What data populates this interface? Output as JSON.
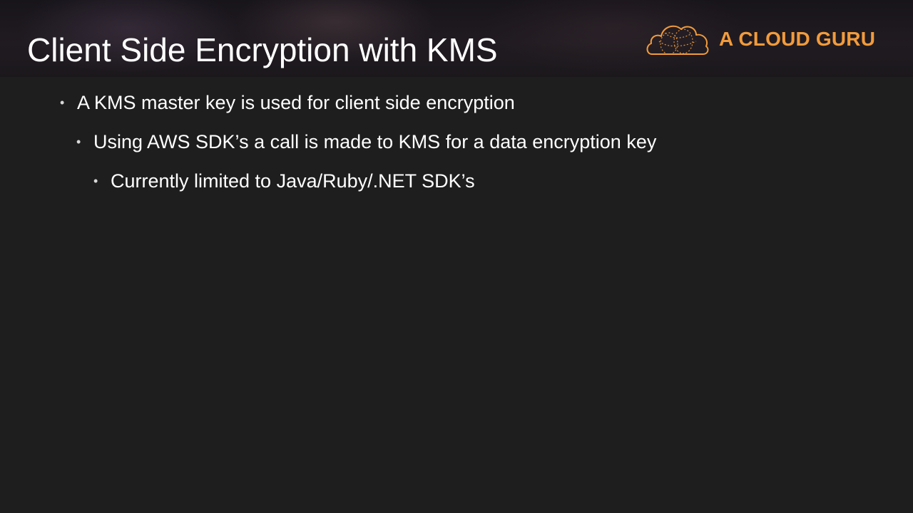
{
  "slide": {
    "title": "Client Side Encryption with KMS",
    "logo_text": "A CLOUD GURU",
    "logo_icon": "cloud-icon",
    "bullets": [
      {
        "level": 1,
        "text": "A KMS master key is used for client side encryption"
      },
      {
        "level": 2,
        "text": "Using AWS SDK’s a call is made to KMS for a data encryption key"
      },
      {
        "level": 3,
        "text": "Currently limited to Java/Ruby/.NET SDK’s"
      }
    ],
    "bullet_glyph": "•"
  },
  "colors": {
    "background": "#1e1e1e",
    "title_text": "#ffffff",
    "body_text": "#ffffff",
    "brand_orange": "#f29b3c"
  }
}
